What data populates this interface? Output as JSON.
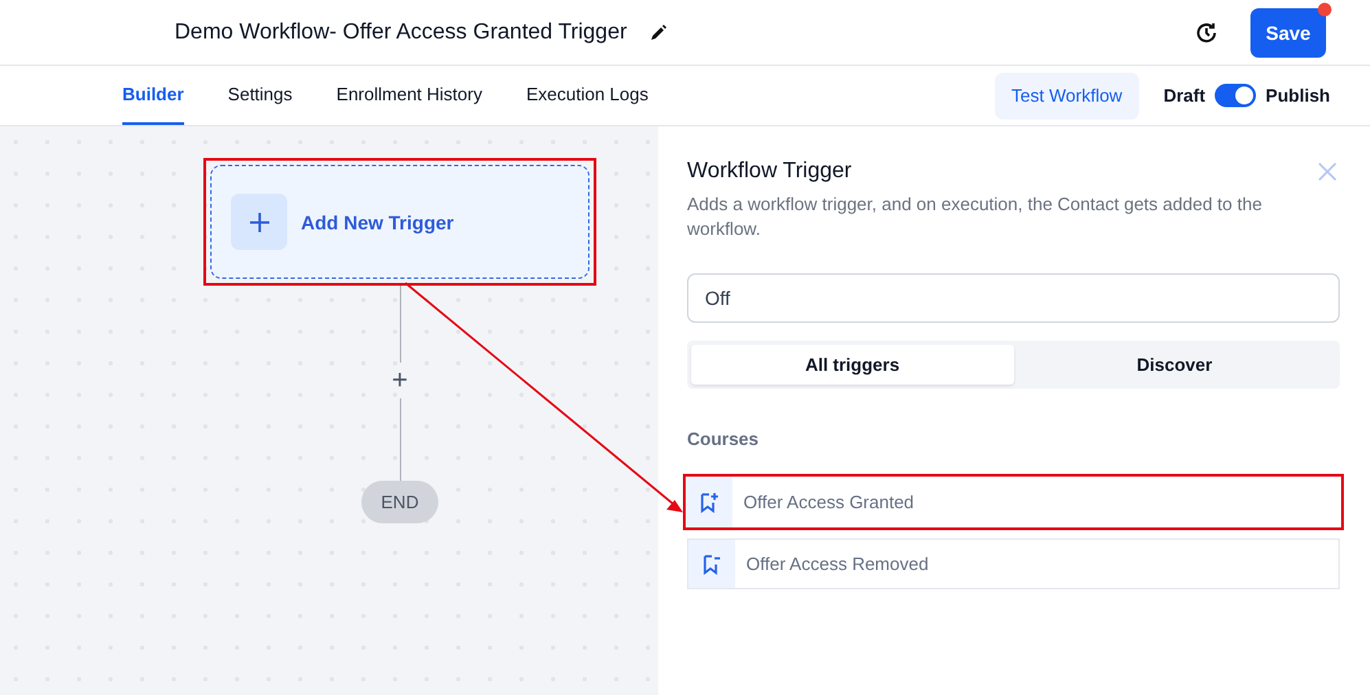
{
  "header": {
    "title": "Demo Workflow- Offer Access Granted Trigger",
    "save": {
      "label": "Save",
      "notification": true
    }
  },
  "tabs": [
    {
      "label": "Builder",
      "selected": true
    },
    {
      "label": "Settings",
      "selected": false
    },
    {
      "label": "Enrollment History",
      "selected": false
    },
    {
      "label": "Execution Logs",
      "selected": false
    }
  ],
  "test_button": "Test Workflow",
  "publish_toggle": {
    "off_label": "Draft",
    "on_label": "Publish",
    "on": true
  },
  "canvas": {
    "trigger_node": {
      "label": "Add New Trigger",
      "highlighted": true
    },
    "add_step": "+",
    "end": "END"
  },
  "panel": {
    "title": "Workflow Trigger",
    "description": "Adds a workflow trigger, and on execution, the Contact gets added to the workflow.",
    "search": {
      "value": "Off"
    },
    "segments": [
      {
        "label": "All triggers",
        "selected": true
      },
      {
        "label": "Discover",
        "selected": false
      }
    ],
    "section": "Courses",
    "items": [
      {
        "label": "Offer Access Granted",
        "kind": "granted",
        "highlighted": true
      },
      {
        "label": "Offer Access Removed",
        "kind": "removed",
        "highlighted": false
      }
    ]
  },
  "annotation": {
    "arrow": true
  }
}
